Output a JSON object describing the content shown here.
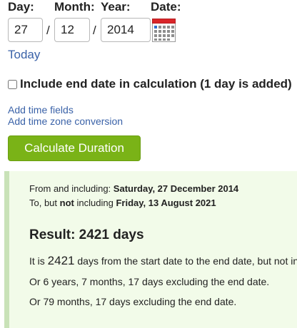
{
  "form": {
    "day_label": "Day:",
    "month_label": "Month:",
    "year_label": "Year:",
    "date_label": "Date:",
    "day_value": "27",
    "month_value": "12",
    "year_value": "2014",
    "separator": "/",
    "calendar_icon": "calendar-icon",
    "today_link": "Today",
    "include_end_label": "Include end date in calculation (1 day is added)",
    "include_end_checked": false,
    "add_time_link": "Add time fields",
    "add_timezone_link": "Add time zone conversion",
    "calculate_button": "Calculate Duration"
  },
  "result": {
    "from_prefix": "From and including:",
    "from_date": "Saturday, 27 December 2014",
    "to_prefix": "To, but",
    "to_not": "not",
    "to_including": "including",
    "to_date": "Friday, 13 August 2021",
    "heading": "Result: 2421 days",
    "summary_prefix": "It is",
    "summary_days": "2421",
    "summary_suffix": "days from the start date to the end date, but not included",
    "alt_years": "Or 6 years, 7 months, 17 days excluding the end date.",
    "alt_months": "Or 79 months, 17 days excluding the end date."
  },
  "colors": {
    "link": "#3a62a8",
    "button": "#7ab317",
    "result_bg": "#f2fbe9",
    "result_border": "#c9e2b8"
  }
}
